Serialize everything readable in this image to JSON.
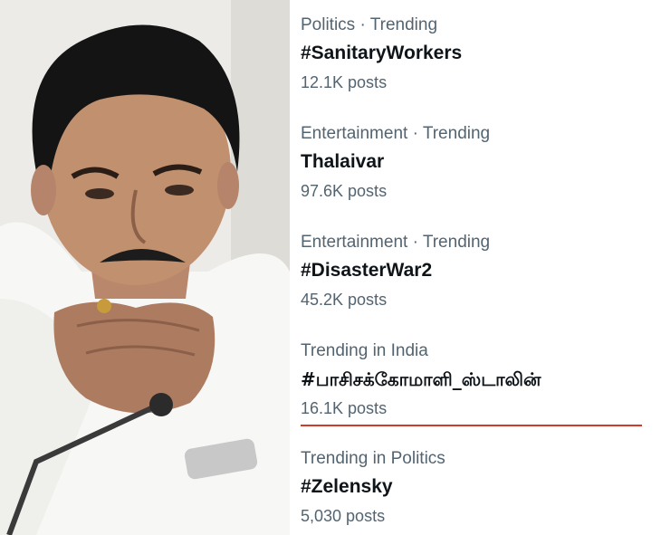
{
  "trends": [
    {
      "meta": "Politics · Trending",
      "tag": "#SanitaryWorkers",
      "posts": "12.1K posts"
    },
    {
      "meta": "Entertainment · Trending",
      "tag": "Thalaivar",
      "posts": "97.6K posts"
    },
    {
      "meta": "Entertainment · Trending",
      "tag": "#DisasterWar2",
      "posts": "45.2K posts"
    },
    {
      "meta": "Trending in India",
      "tag": "#பாசிசக்கோமாளி_ஸ்டாலின்",
      "posts": "16.1K posts"
    },
    {
      "meta": "Trending in Politics",
      "tag": "#Zelensky",
      "posts": "5,030 posts"
    }
  ],
  "colors": {
    "meta_text": "#536471",
    "tag_text": "#0f1419",
    "highlight_underline": "#d13b2c"
  }
}
